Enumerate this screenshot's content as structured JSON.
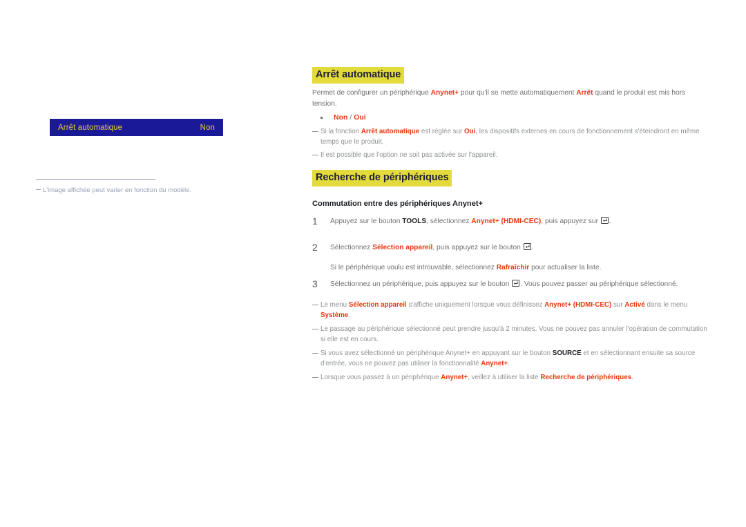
{
  "left_panel": {
    "osd": {
      "label": "Arrêt automatique",
      "value": "Non",
      "bg_color": "#1a1a99",
      "text_color": "#e8c832"
    },
    "footnote": "L'image affichée peut varier en fonction du modèle."
  },
  "content": {
    "section_1": {
      "heading": "Arrêt automatique",
      "intro": {
        "t1": "Permet de configurer un périphérique ",
        "k1": "Anynet+",
        "t2": " pour qu'il se mette automatiquement ",
        "k2": "Arrêt",
        "t3": " quand le produit est mis hors tension."
      },
      "bullet": {
        "option_1": "Non",
        "separator": " / ",
        "option_2": "Oui"
      },
      "note_1": {
        "t1": "Si la fonction ",
        "k1": "Arrêt automatique",
        "t2": " est réglée sur ",
        "k2": "Oui",
        "t3": ", les dispositifs externes en cours de fonctionnement s'éteindront en même temps que le produit."
      },
      "note_2": {
        "t1": "Il est possible que l'option ne soit pas activée sur l'appareil."
      }
    },
    "section_2": {
      "heading": "Recherche de périphériques",
      "sub_heading": "Commutation entre des périphériques Anynet+",
      "steps": [
        {
          "num": "1",
          "t1": "Appuyez sur le bouton ",
          "k1": "TOOLS",
          "t2": ", sélectionnez ",
          "k2": "Anynet+ (HDMI-CEC)",
          "t3": ", puis appuyez sur ",
          "icon": "enter-key-icon",
          "t4": "."
        },
        {
          "num": "2",
          "t1": "Sélectionnez ",
          "k1": "Sélection appareil",
          "t2": ", puis appuyez sur le bouton ",
          "icon": "enter-key-icon",
          "t3": "."
        },
        {
          "num": "3",
          "t1": "Sélectionnez un périphérique, puis appuyez sur le bouton ",
          "icon": "enter-key-icon",
          "t2": ". Vous pouvez passer au périphérique sélectionné."
        }
      ],
      "step_2_sub": {
        "t1": "Si le périphérique voulu est introuvable, sélectionnez ",
        "k1": "Rafraîchir",
        "t2": " pour actualiser la liste."
      },
      "note_3": {
        "t1": "Le menu ",
        "k1": "Sélection appareil",
        "t2": " s'affiche uniquement lorsque vous définissez ",
        "k2": "Anynet+ (HDMI-CEC)",
        "t3": " sur ",
        "k3": "Activé",
        "t4": " dans le menu ",
        "k4": "Système",
        "t5": "."
      },
      "note_4": {
        "t1": "Le passage au périphérique sélectionné peut prendre jusqu'à 2 minutes. Vous ne pouvez pas annuler l'opération de commutation si elle est en cours."
      },
      "note_5": {
        "t1": "Si vous avez sélectionné un périphérique Anynet+ en appuyant sur le bouton ",
        "k1": "SOURCE",
        "t2": " et en sélectionnant ensuite sa source d'entrée, vous ne pouvez pas utiliser la fonctionnalité ",
        "k2": "Anynet+",
        "t3": "."
      },
      "note_6": {
        "t1": "Lorsque vous passez à un périphérique ",
        "k1": "Anynet+",
        "t2": ", veillez à utiliser la liste ",
        "k2": "Recherche de périphériques",
        "t3": "."
      }
    }
  },
  "colors": {
    "highlight": "#e3da3c",
    "accent_red": "#e8380d",
    "osd_blue": "#1a1a99",
    "osd_gold": "#e8c832",
    "body_gray": "#6c6f72",
    "note_gray": "#8d9195"
  }
}
